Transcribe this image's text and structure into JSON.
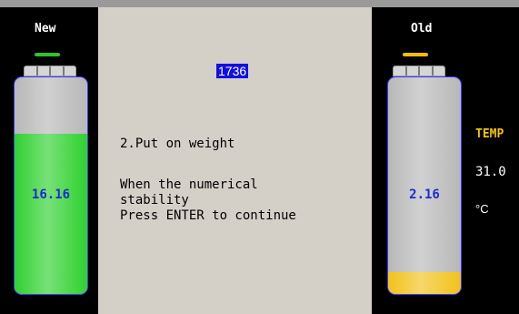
{
  "left": {
    "title": "New",
    "value": "16.16",
    "status_color": "#31c131",
    "fill_color": "#2fd12f",
    "fill_level": 0.74
  },
  "right": {
    "title": "Old",
    "value": "2.16",
    "status_color": "#f0c000",
    "fill_color": "#f2c21a",
    "fill_level": 0.1
  },
  "center": {
    "counter": "1736",
    "step": "2.Put on weight",
    "line1": "When the numerical",
    "line2": "stability",
    "line3": "Press ENTER to continue"
  },
  "temp": {
    "label": "TEMP",
    "value": "31.0",
    "unit": "°C"
  }
}
